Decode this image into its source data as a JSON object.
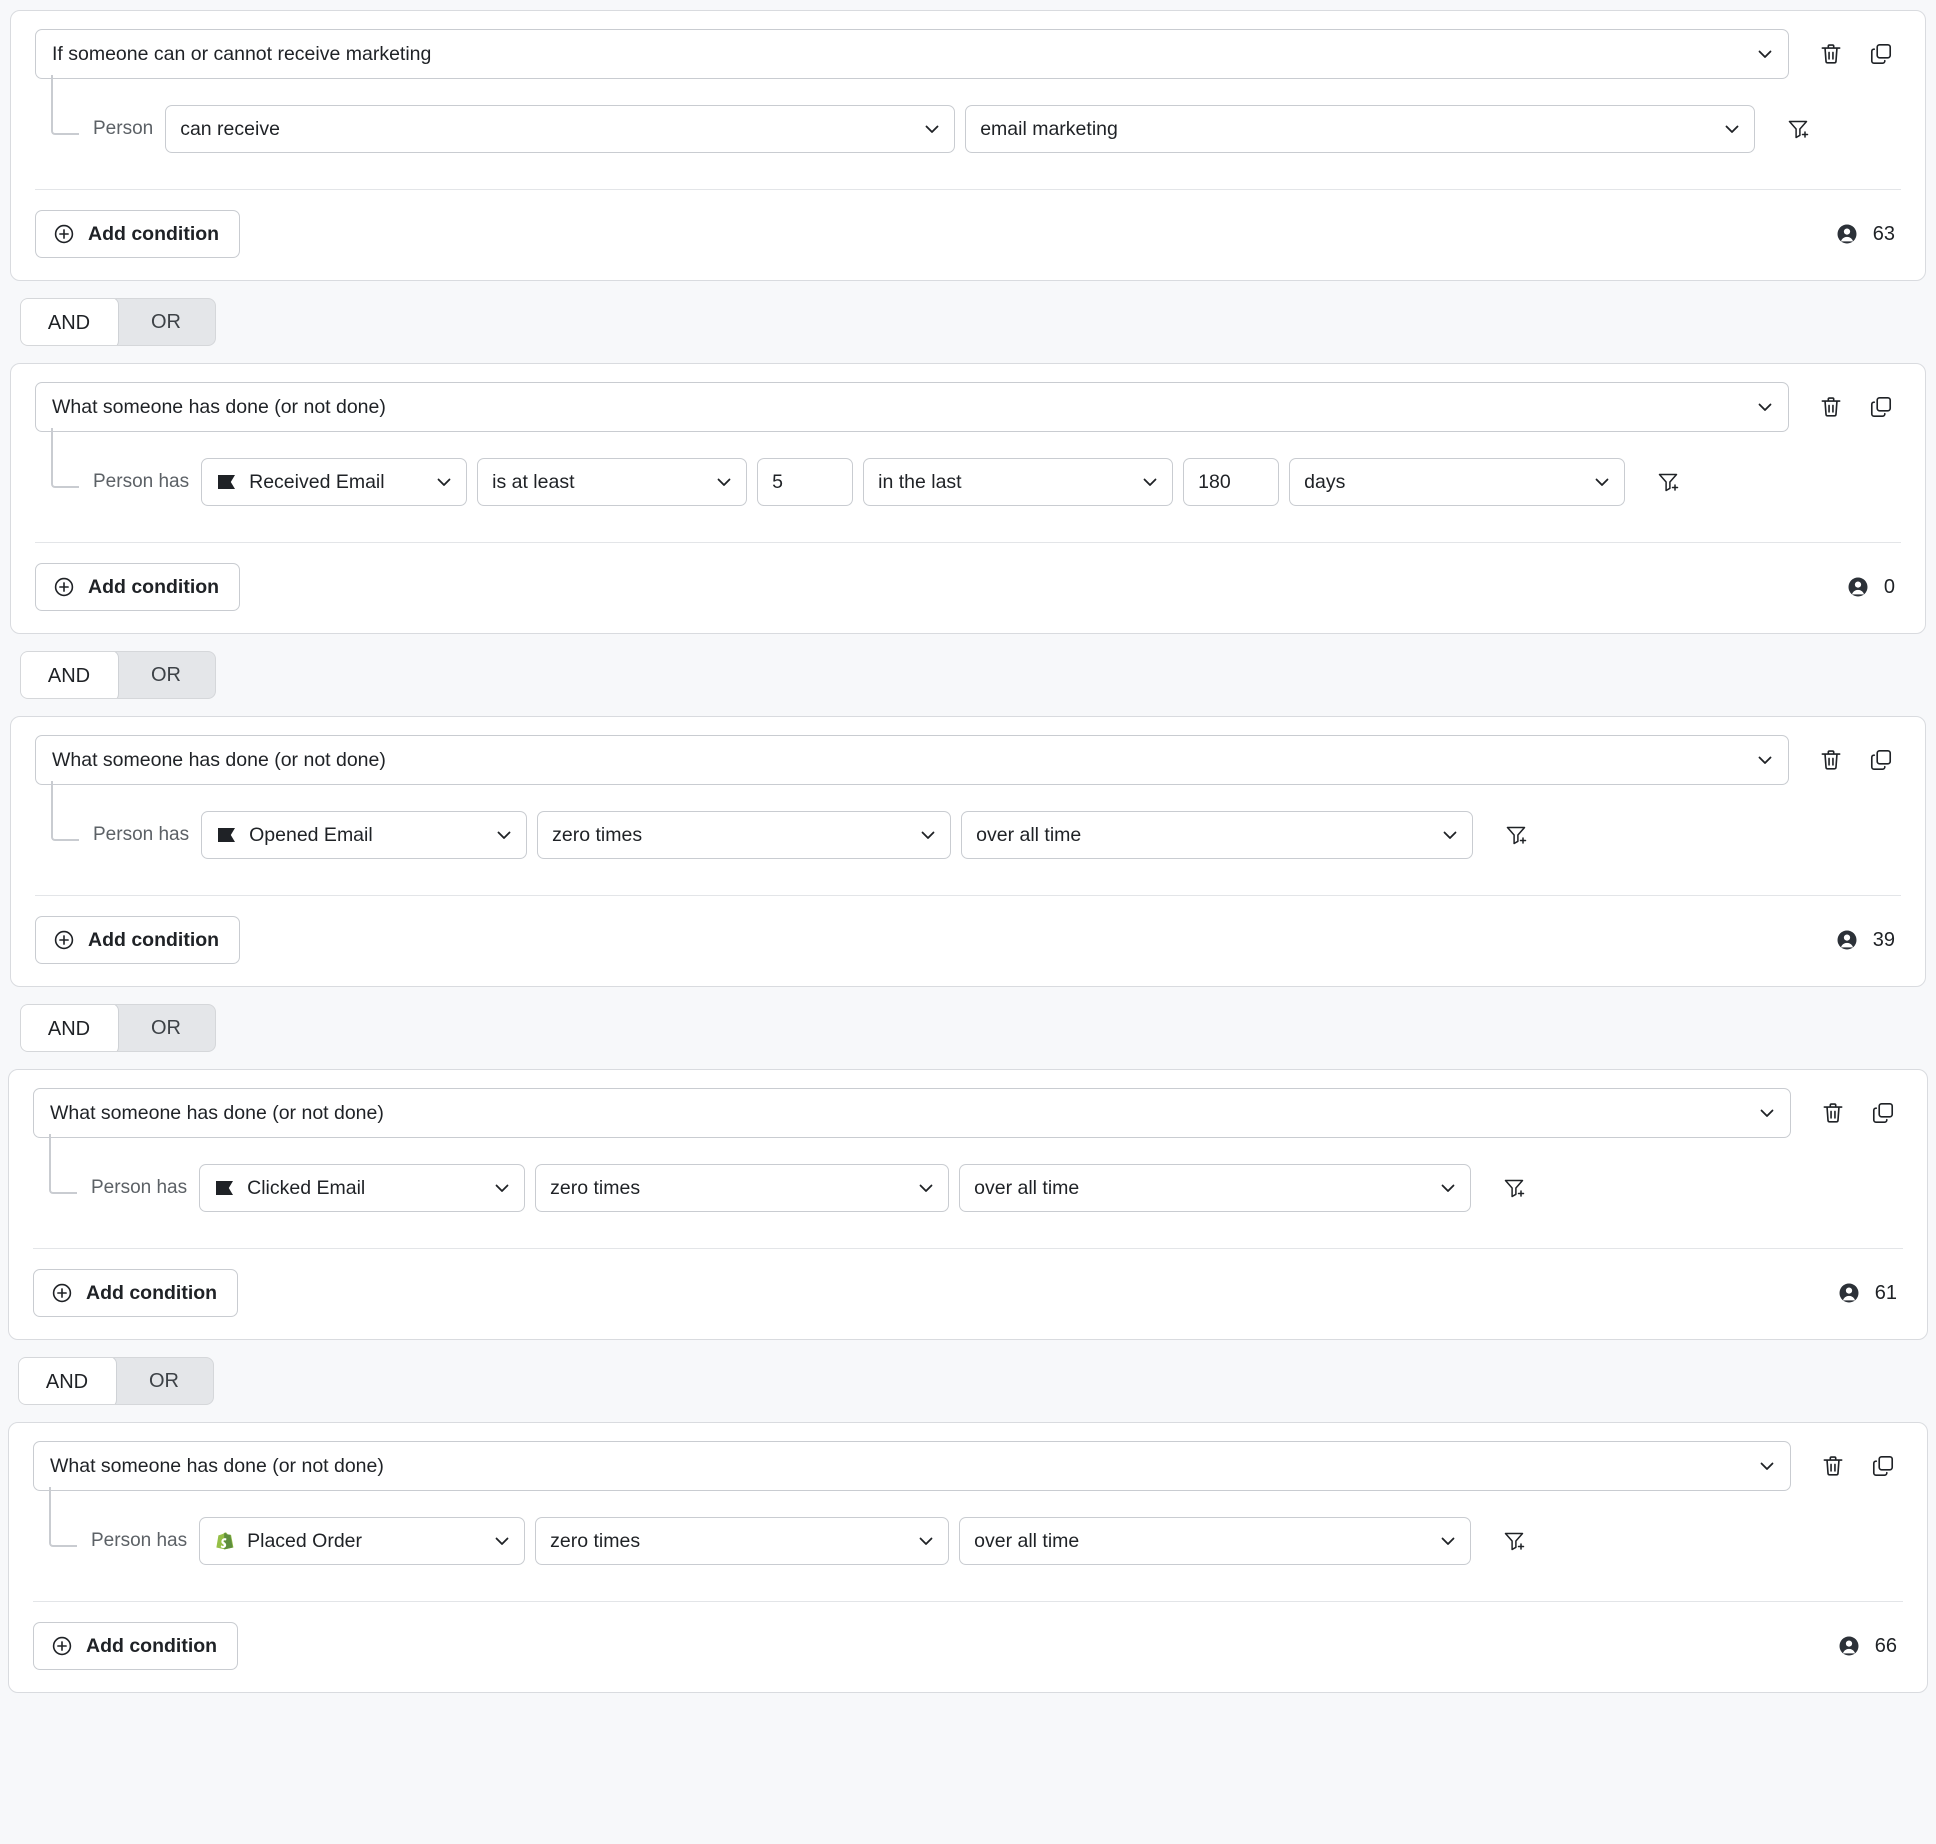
{
  "labels": {
    "add_condition": "Add condition",
    "person": "Person",
    "person_has": "Person has",
    "and": "AND",
    "or": "OR"
  },
  "icons": {
    "trash": "trash-icon",
    "duplicate": "duplicate-icon",
    "filter_add": "filter-add-icon",
    "chevron_down": "chevron-down-icon",
    "plus_circle": "plus-circle-icon",
    "person": "person-icon",
    "flag": "flag-icon",
    "shopify": "shopify-icon"
  },
  "colors": {
    "shopify_green": "#95bf47",
    "text": "#1f2226",
    "muted": "#5c6166",
    "border": "#d9dbdf"
  },
  "groups": [
    {
      "id": "group-1",
      "type": "consent",
      "definition": "If someone can or cannot receive marketing",
      "condition_label": "Person",
      "fields": [
        {
          "name": "consent-status",
          "value": "can receive",
          "kind": "select"
        },
        {
          "name": "consent-channel",
          "value": "email marketing",
          "kind": "select"
        }
      ],
      "profile_count": "63"
    },
    {
      "id": "group-2",
      "type": "activity",
      "definition": "What someone has done (or not done)",
      "condition_label": "Person has",
      "fields": [
        {
          "name": "metric",
          "value": "Received Email",
          "kind": "select",
          "glyph": "flag"
        },
        {
          "name": "operator",
          "value": "is at least",
          "kind": "select"
        },
        {
          "name": "value",
          "value": "5",
          "kind": "input"
        },
        {
          "name": "timeframe",
          "value": "in the last",
          "kind": "select"
        },
        {
          "name": "duration",
          "value": "180",
          "kind": "input"
        },
        {
          "name": "unit",
          "value": "days",
          "kind": "select"
        }
      ],
      "profile_count": "0"
    },
    {
      "id": "group-3",
      "type": "activity",
      "definition": "What someone has done (or not done)",
      "condition_label": "Person has",
      "fields": [
        {
          "name": "metric",
          "value": "Opened Email",
          "kind": "select",
          "glyph": "flag"
        },
        {
          "name": "operator",
          "value": "zero times",
          "kind": "select"
        },
        {
          "name": "timeframe",
          "value": "over all time",
          "kind": "select"
        }
      ],
      "profile_count": "39"
    },
    {
      "id": "group-4",
      "type": "activity",
      "definition": "What someone has done (or not done)",
      "condition_label": "Person has",
      "fields": [
        {
          "name": "metric",
          "value": "Clicked Email",
          "kind": "select",
          "glyph": "flag"
        },
        {
          "name": "operator",
          "value": "zero times",
          "kind": "select"
        },
        {
          "name": "timeframe",
          "value": "over all time",
          "kind": "select"
        }
      ],
      "profile_count": "61"
    },
    {
      "id": "group-5",
      "type": "activity",
      "definition": "What someone has done (or not done)",
      "condition_label": "Person has",
      "fields": [
        {
          "name": "metric",
          "value": "Placed Order",
          "kind": "select",
          "glyph": "shopify"
        },
        {
          "name": "operator",
          "value": "zero times",
          "kind": "select"
        },
        {
          "name": "timeframe",
          "value": "over all time",
          "kind": "select"
        }
      ],
      "profile_count": "66"
    }
  ],
  "conjunctions": [
    {
      "id": "conj-1",
      "selected": "AND"
    },
    {
      "id": "conj-2",
      "selected": "AND"
    },
    {
      "id": "conj-3",
      "selected": "AND"
    },
    {
      "id": "conj-4",
      "selected": "AND"
    }
  ]
}
